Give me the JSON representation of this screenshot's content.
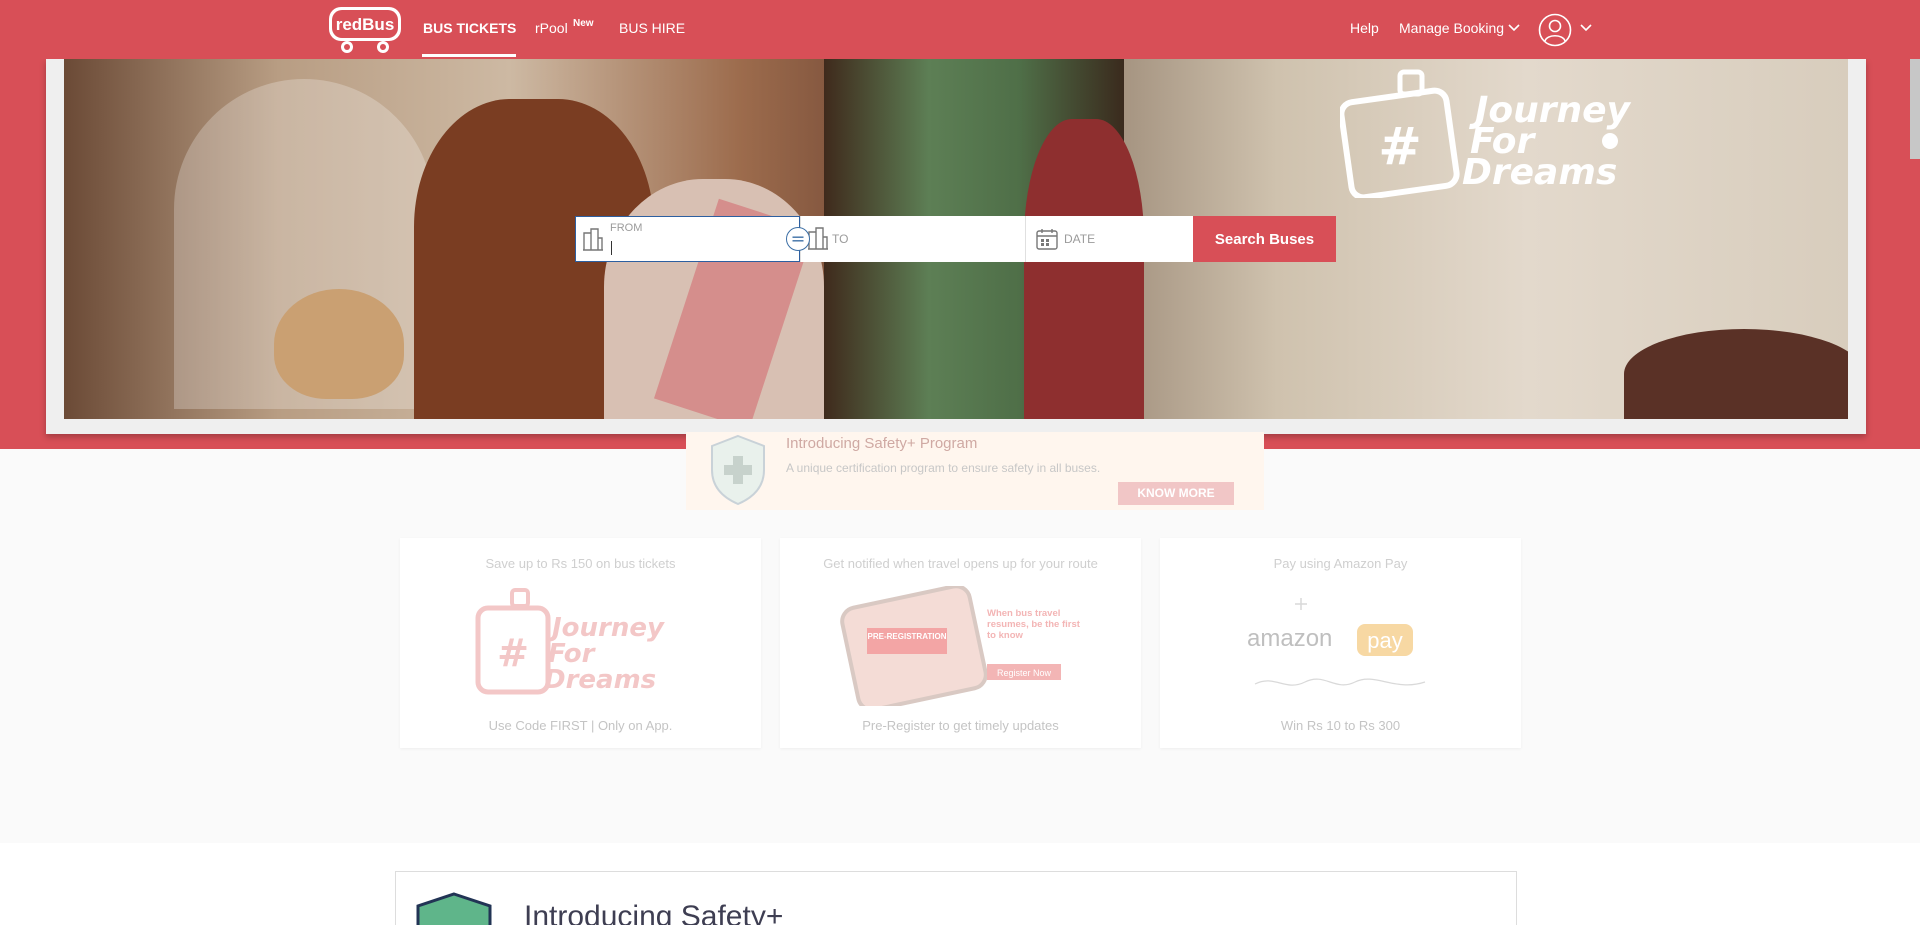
{
  "nav": {
    "logo_text": "redBus",
    "links": [
      "BUS TICKETS",
      "rPool",
      "BUS HIRE"
    ],
    "new_badge": "New",
    "help": "Help",
    "manage_booking": "Manage Booking"
  },
  "hero": {
    "banner_lines": [
      "Journey",
      "For",
      "Dreams"
    ],
    "banner_hashtag": "#"
  },
  "search": {
    "from_label": "FROM",
    "to_label": "TO",
    "date_label": "DATE",
    "button": "Search Buses"
  },
  "safety": {
    "title": "Introducing Safety+ Program",
    "description": "A unique certification program to ensure safety in all buses.",
    "button": "KNOW MORE"
  },
  "offers": [
    {
      "title": "Save up to Rs 150 on bus tickets",
      "footer": "Use Code FIRST | Only on App."
    },
    {
      "title": "Get notified when travel opens up for your route",
      "footer": "Pre-Register to get timely updates",
      "promo_text": "When bus travel resumes, be the first to know",
      "promo_button": "Register Now",
      "badge": "PRE-REGISTRATION"
    },
    {
      "title": "Pay using Amazon Pay",
      "footer": "Win Rs 10 to Rs 300",
      "brand": "amazon",
      "brand2": "pay"
    }
  ],
  "bottom": {
    "title": "Introducing Safety+"
  },
  "colors": {
    "brand": "#d84f57"
  }
}
